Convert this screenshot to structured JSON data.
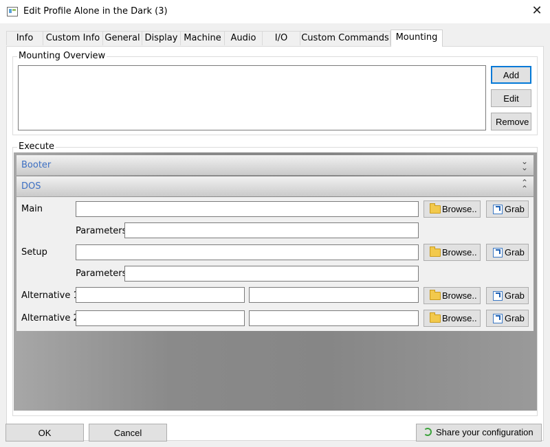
{
  "window": {
    "title": "Edit Profile Alone in the Dark (3)",
    "close_glyph": "✕"
  },
  "tabs": [
    "Info",
    "Custom Info",
    "General",
    "Display",
    "Machine",
    "Audio",
    "I/O",
    "Custom Commands",
    "Mounting"
  ],
  "active_tab": "Mounting",
  "mounting": {
    "group_title": "Mounting Overview",
    "add_label": "Add",
    "edit_label": "Edit",
    "remove_label": "Remove"
  },
  "execute": {
    "group_title": "Execute",
    "booter_label": "Booter",
    "dos_label": "DOS",
    "main_label": "Main",
    "setup_label": "Setup",
    "parameters_label": "Parameters",
    "alt1_label": "Alternative 1",
    "alt2_label": "Alternative 2",
    "browse_label": "Browse..",
    "grab_label": "Grab"
  },
  "footer": {
    "ok": "OK",
    "cancel": "Cancel",
    "share": "Share your configuration"
  },
  "icons": {
    "folder": "folder-icon",
    "grab": "grab-icon",
    "refresh": "refresh-icon",
    "expand": "chevron-double-down-icon",
    "collapse": "chevron-double-up-icon"
  },
  "colors": {
    "accent": "#0078d7",
    "section_link": "#3c6fc2"
  }
}
